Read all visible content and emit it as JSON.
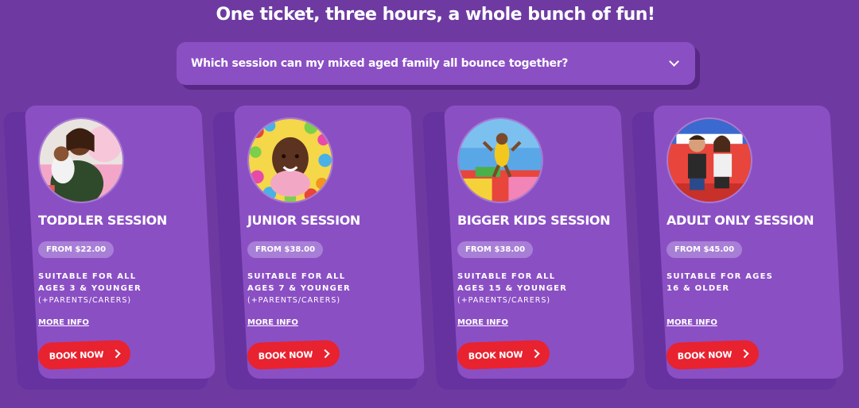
{
  "page": {
    "title": "One ticket, three hours, a whole bunch of fun!"
  },
  "faq": {
    "question": "Which session can my mixed aged family all bounce together?",
    "icon": "chevron-down-icon"
  },
  "cards": [
    {
      "title": "TODDLER SESSION",
      "price": "FROM $22.00",
      "suitable_line1": "SUITABLE FOR ALL",
      "suitable_line2": "AGES 3 & YOUNGER",
      "suitable_line3": "(+PARENTS/CARERS)",
      "more_info": "MORE INFO",
      "book": "BOOK NOW"
    },
    {
      "title": "JUNIOR SESSION",
      "price": "FROM $38.00",
      "suitable_line1": "SUITABLE FOR ALL",
      "suitable_line2": "AGES 7 & YOUNGER",
      "suitable_line3": "(+PARENTS/CARERS)",
      "more_info": "MORE INFO",
      "book": "BOOK NOW"
    },
    {
      "title": "BIGGER KIDS SESSION",
      "price": "FROM $38.00",
      "suitable_line1": "SUITABLE FOR ALL",
      "suitable_line2": "AGES 15 & YOUNGER",
      "suitable_line3": "(+PARENTS/CARERS)",
      "more_info": "MORE INFO",
      "book": "BOOK NOW"
    },
    {
      "title": "ADULT ONLY SESSION",
      "price": "FROM $45.00",
      "suitable_line1": "SUITABLE FOR AGES",
      "suitable_line2": "16 & OLDER",
      "suitable_line3": "",
      "more_info": "MORE INFO",
      "book": "BOOK NOW"
    }
  ],
  "colors": {
    "background": "#6e3aa1",
    "card": "#8b4fc4",
    "badge": "#a87fd6",
    "button": "#e8222f",
    "text": "#ffffff"
  }
}
